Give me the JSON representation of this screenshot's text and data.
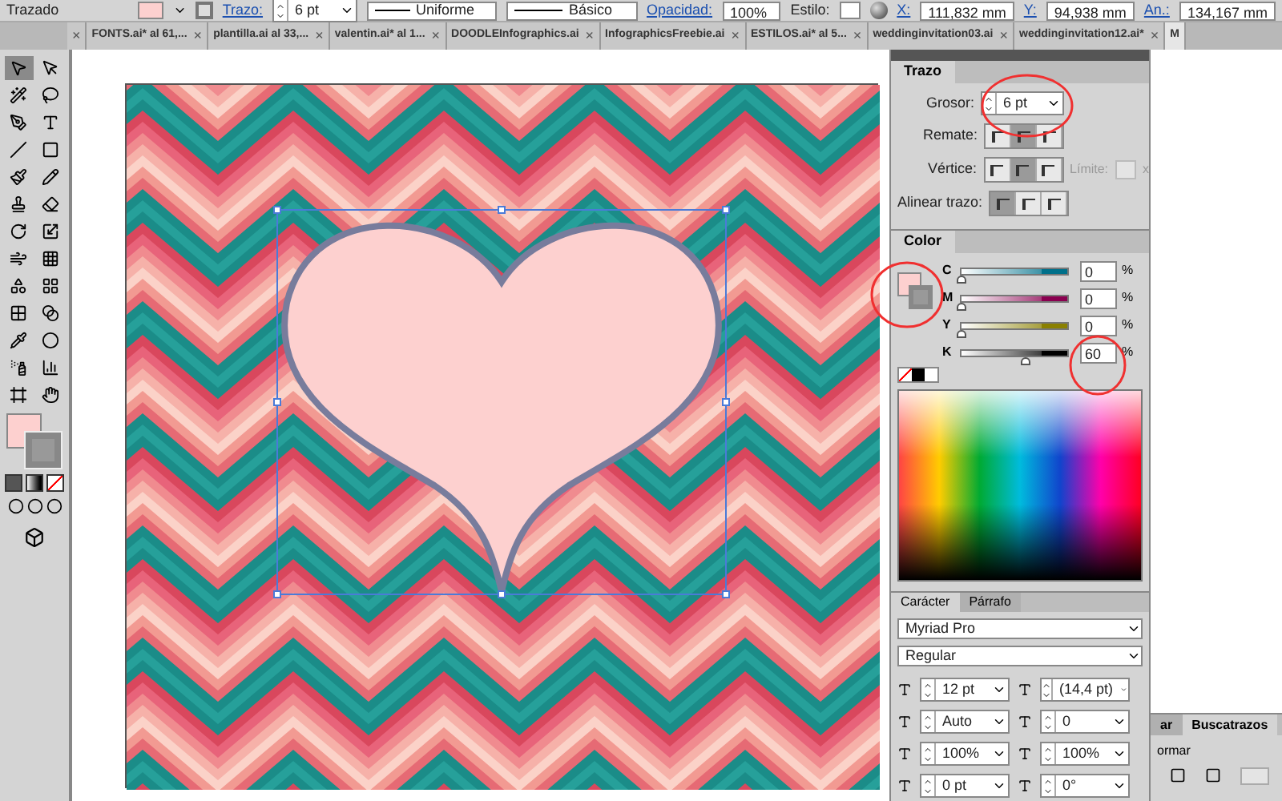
{
  "control_bar": {
    "mode": "Trazado",
    "stroke_label": "Trazo:",
    "stroke_value": "6 pt",
    "profile": "Uniforme",
    "brush": "Básico",
    "opacity_label": "Opacidad:",
    "opacity": "100%",
    "style_label": "Estilo:",
    "x_label": "X:",
    "x": "111,832 mm",
    "y_label": "Y:",
    "y": "94,938 mm",
    "w_label": "An.:",
    "w": "134,167 mm"
  },
  "tabs": [
    {
      "close": "×",
      "selected": false
    },
    {
      "label": "FONTS.ai* al 61,...",
      "close": "×",
      "selected": false
    },
    {
      "label": "plantilla.ai al 33,...",
      "close": "×",
      "selected": false
    },
    {
      "label": "valentin.ai* al 1...",
      "close": "×",
      "selected": false
    },
    {
      "label": "DOODLEInfographics.ai",
      "close": "×",
      "selected": false
    },
    {
      "label": "InfographicsFreebie.ai",
      "close": "×",
      "selected": false
    },
    {
      "label": "ESTILOS.ai* al 5...",
      "close": "×",
      "selected": false
    },
    {
      "label": "weddinginvitation03.ai",
      "close": "×",
      "selected": false
    },
    {
      "label": "weddinginvitation12.ai*",
      "close": "×",
      "selected": false
    },
    {
      "label": "M",
      "selected": true
    }
  ],
  "tools": [
    {
      "selected": true
    },
    {
      "selected": false
    },
    {
      "selected": false
    },
    {
      "selected": false
    },
    {
      "selected": false
    },
    {
      "selected": false
    },
    {
      "selected": false
    },
    {
      "selected": false
    },
    {
      "selected": false
    },
    {
      "selected": false
    },
    {
      "selected": false
    },
    {
      "selected": false
    },
    {
      "selected": false
    },
    {
      "selected": false
    },
    {
      "selected": false
    },
    {
      "selected": false
    },
    {
      "selected": false
    },
    {
      "selected": false
    },
    {
      "selected": false
    },
    {
      "selected": false
    },
    {
      "selected": false
    },
    {
      "selected": false
    },
    {
      "selected": false
    },
    {
      "selected": false
    },
    {
      "selected": false
    },
    {
      "selected": false
    }
  ],
  "stroke_panel": {
    "title": "Trazo",
    "weight_label": "Grosor:",
    "weight": "6 pt",
    "cap_label": "Remate:",
    "caps": [
      {
        "selected": false
      },
      {
        "selected": true
      },
      {
        "selected": false
      }
    ],
    "corner_label": "Vértice:",
    "corners": [
      {
        "selected": false
      },
      {
        "selected": true
      },
      {
        "selected": false
      }
    ],
    "limit_label": "Límite:",
    "limit_unit": "x",
    "align_label": "Alinear trazo:",
    "align": [
      {
        "selected": true
      },
      {
        "selected": false
      },
      {
        "selected": false
      }
    ]
  },
  "color_panel": {
    "title": "Color",
    "sliders": [
      {
        "name": "C",
        "value": "0",
        "unit": "%",
        "level": 0,
        "color": "#00708a"
      },
      {
        "name": "M",
        "value": "0",
        "unit": "%",
        "level": 0,
        "color": "#8a0050"
      },
      {
        "name": "Y",
        "value": "0",
        "unit": "%",
        "level": 0,
        "color": "#8a8000"
      },
      {
        "name": "K",
        "value": "60",
        "unit": "%",
        "level": 0.6,
        "color": "#000000"
      }
    ]
  },
  "character_panel": {
    "tabs": [
      {
        "label": "Carácter",
        "selected": true
      },
      {
        "label": "Párrafo",
        "selected": false
      }
    ],
    "font": "Myriad Pro",
    "style": "Regular",
    "size": "12 pt",
    "leading": "(14,4 pt)",
    "kerning": "Auto",
    "tracking": "0",
    "vscale": "100%",
    "hscale": "100%",
    "baseline": "0 pt",
    "rotation": "0°"
  },
  "pathfinder_panel": {
    "tabs": [
      {
        "label": "ar",
        "selected": false
      },
      {
        "label": "Buscatrazos",
        "selected": true
      }
    ],
    "label": "ormar"
  }
}
